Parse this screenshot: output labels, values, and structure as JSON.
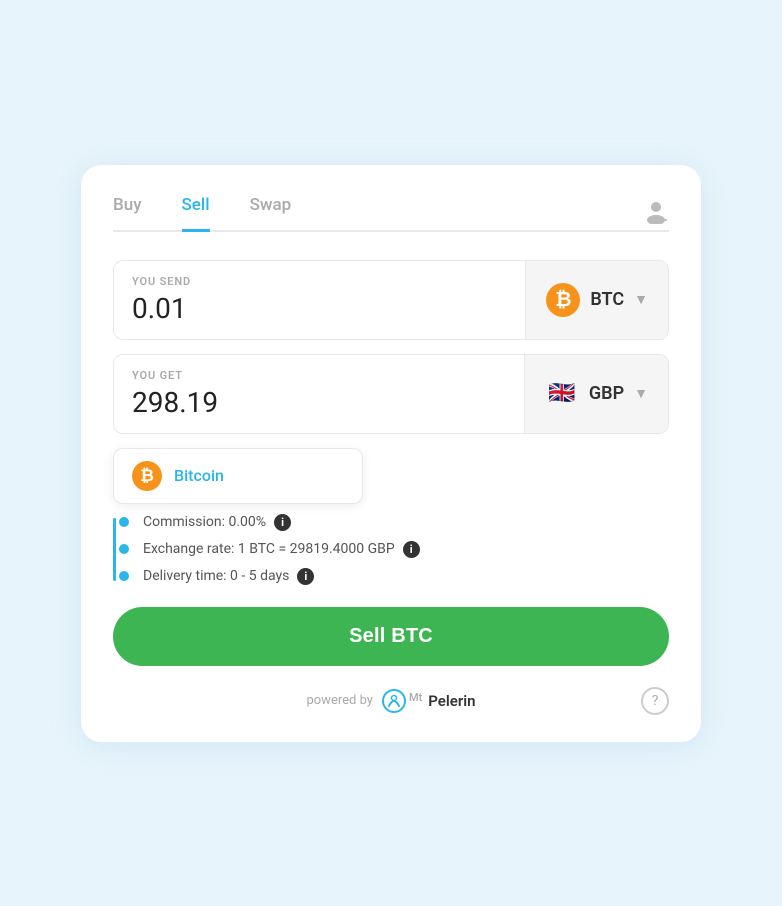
{
  "tabs": {
    "buy": "Buy",
    "sell": "Sell",
    "swap": "Swap",
    "active": "Sell"
  },
  "send": {
    "label": "YOU SEND",
    "value": "0.01",
    "currency": "BTC",
    "currency_icon": "₿"
  },
  "get": {
    "label": "YOU GET",
    "value": "298.19",
    "currency": "GBP",
    "currency_flag": "🇬🇧"
  },
  "suggestion": {
    "label": "Bitcoin"
  },
  "info": {
    "commission": "Commission: 0.00%",
    "exchange_rate": "Exchange rate: 1 BTC = 29819.4000 GBP",
    "delivery_time": "Delivery time: 0 - 5 days"
  },
  "sell_button": "Sell BTC",
  "footer": {
    "powered_by": "powered by",
    "brand": "Pelerin",
    "brand_prefix": "Mt"
  }
}
